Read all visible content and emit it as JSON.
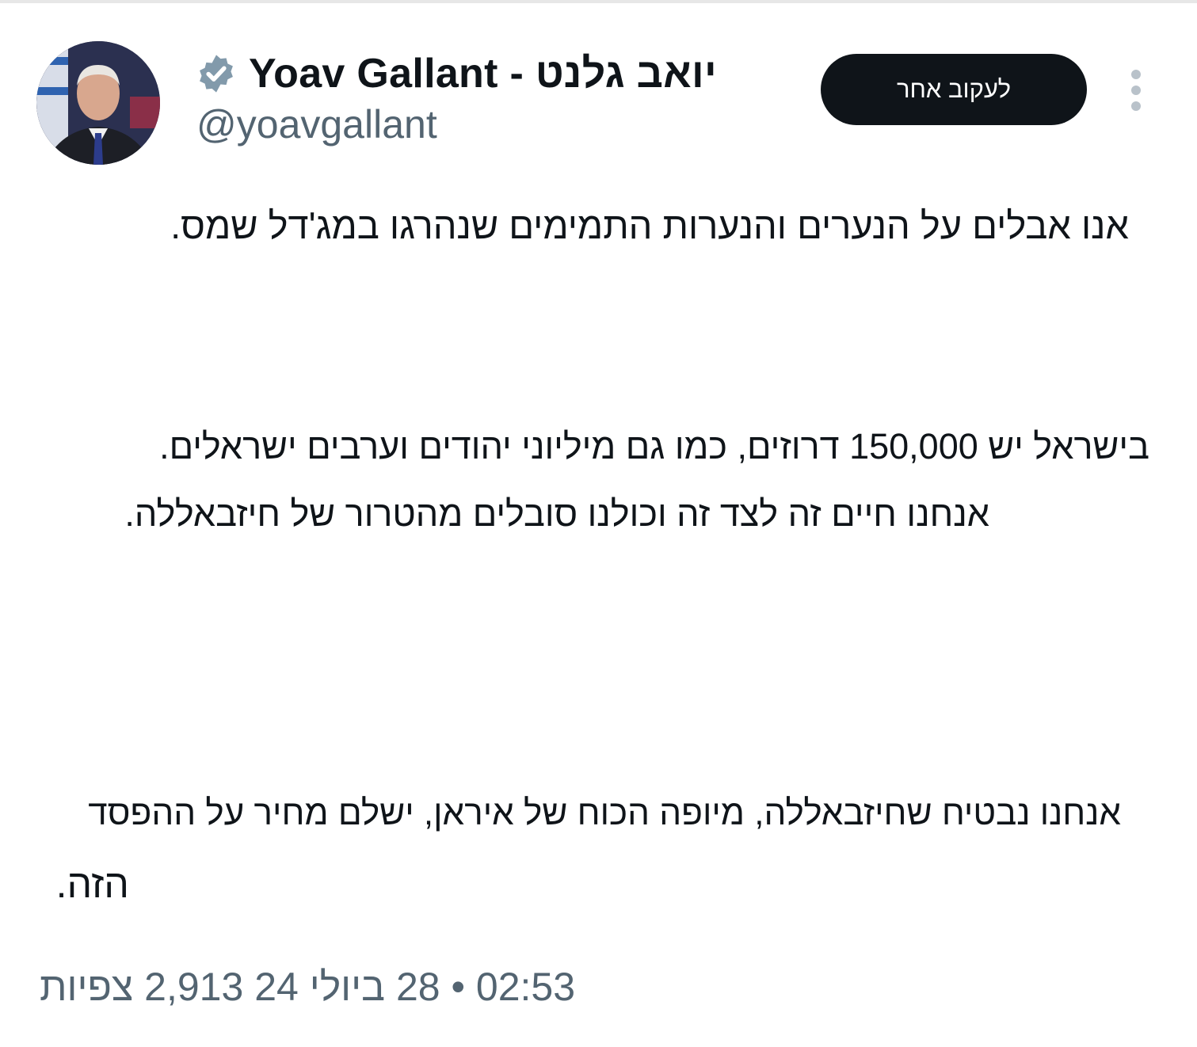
{
  "author": {
    "display_name": "Yoav Gallant - יואב גלנט",
    "handle": "@yoavgallant"
  },
  "actions": {
    "follow_label": "לעקוב אחר"
  },
  "tweet": {
    "lines": [
      "אנו אבלים על הנערים והנערות התמימים שנהרגו במג'דל שמס.",
      "בישראל יש 150,000 דרוזים, כמו גם מיליוני יהודים וערבים ישראלים.",
      "אנחנו חיים זה לצד זה וכולנו סובלים מהטרור של חיזבאללה.",
      "אנחנו נבטיח שחיזבאללה, מיופה הכוח של איראן, ישלם מחיר על ההפסד",
      "הזה."
    ]
  },
  "meta": {
    "text": "02:53 • 28 ביולי 24 2,913 צפיות"
  },
  "colors": {
    "text": "#0f1419",
    "secondary": "#536471",
    "button_bg": "#0f1419",
    "verified_badge": "#829aab"
  },
  "icons": {
    "verified": "verified-badge-icon",
    "more": "more-vertical-icon"
  }
}
